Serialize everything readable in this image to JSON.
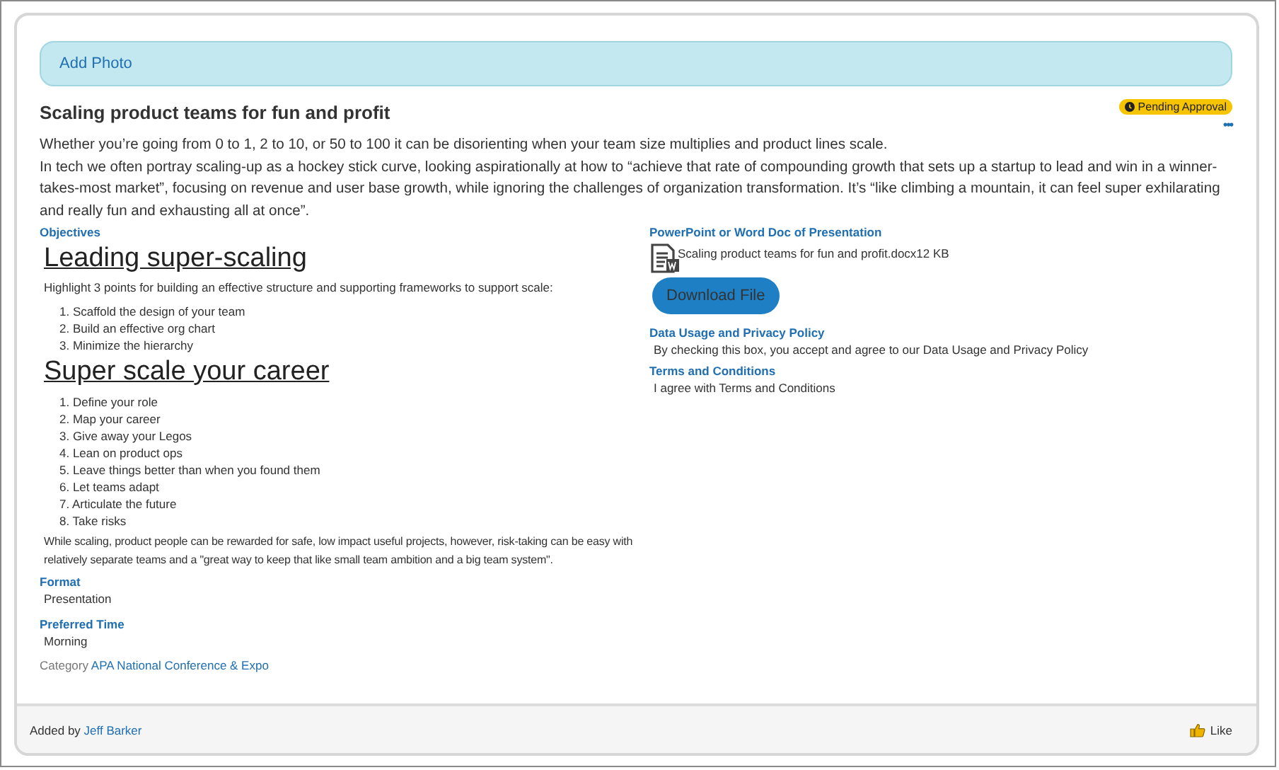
{
  "add_photo": {
    "label": "Add Photo"
  },
  "title": "Scaling product teams for fun and profit",
  "status_badge": {
    "label": "Pending Approval"
  },
  "more_menu": {
    "label": "•••"
  },
  "description": [
    "Whether you’re going from 0 to 1, 2 to 10, or 50 to 100 it can be disorienting when your team size multiplies and product lines scale.",
    "In tech we often portray scaling-up as a hockey stick curve, looking aspirationally at how to “achieve that rate of compounding growth that sets up a startup to lead and win in a winner-takes-most market”, focusing on revenue and user base growth, while ignoring the challenges of organization transformation. It’s “like climbing a mountain, it can feel super exhilarating and really fun and exhausting all at once”."
  ],
  "objectives": {
    "label": "Objectives",
    "sections": [
      {
        "heading": "Leading super-scaling",
        "intro": "Highlight 3 points for building an effective structure and supporting frameworks to support scale:",
        "items": [
          "1. Scaffold the design of your team",
          "2. Build an effective org chart",
          "3. Minimize the hierarchy"
        ]
      },
      {
        "heading": "Super scale your career",
        "items": [
          "1. Define your role",
          "2. Map your career",
          "3. Give away your Legos",
          "4. Lean on product ops",
          "5. Leave things better than when you found them",
          "6. Let teams adapt",
          "7. Articulate the future",
          "8. Take risks"
        ],
        "outro": "While scaling, product people can be rewarded for safe, low impact useful projects, however, risk-taking can be easy with relatively separate teams and a \"great way to keep that like small team ambition and a big team system\"."
      }
    ]
  },
  "fields": [
    {
      "label": "Format",
      "value": "Presentation"
    },
    {
      "label": "Preferred Time",
      "value": "Morning"
    }
  ],
  "category": {
    "label": "Category",
    "value": "APA National Conference & Expo"
  },
  "attachment": {
    "label": "PowerPoint or Word Doc of Presentation",
    "file_name": "Scaling product teams for fun and profit.docx",
    "size": "12 KB",
    "button": "Download File"
  },
  "agreements": [
    {
      "label": "Data Usage and Privacy Policy",
      "text": "By checking this box, you accept and agree to our Data Usage and Privacy Policy"
    },
    {
      "label": "Terms and Conditions",
      "text": "I agree with Terms and Conditions"
    }
  ],
  "footer": {
    "added_by_label": "Added by",
    "author": "Jeff Barker",
    "like": "Like"
  }
}
